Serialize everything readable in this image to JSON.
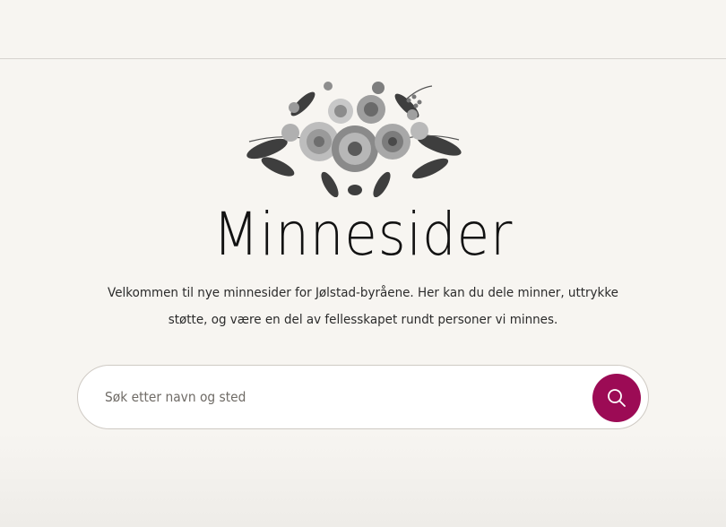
{
  "hero": {
    "title": "Minnesider",
    "intro_line1": "Velkommen til nye minnesider for Jølstad-byråene. Her kan du dele minner, uttrykke",
    "intro_line2": "støtte, og være en del av fellesskapet rundt personer vi minnes.",
    "decoration_icon": "flower-bouquet-illustration"
  },
  "search": {
    "placeholder": "Søk etter navn og sted",
    "value": "",
    "button_icon": "search-icon"
  },
  "colors": {
    "background": "#f7f5f1",
    "accent": "#9c0b55",
    "text": "#1f1f1f"
  }
}
